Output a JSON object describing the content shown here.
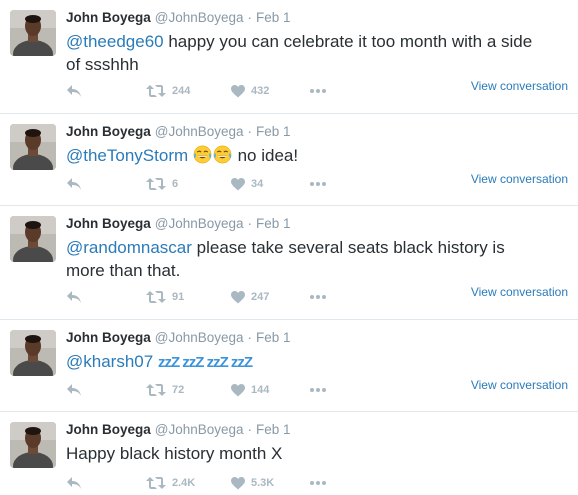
{
  "tweets": [
    {
      "name": "John Boyega",
      "handle": "@JohnBoyega",
      "separator": "·",
      "date": "Feb 1",
      "mention": "@theedge60",
      "text": " happy you can celebrate it too month with a side of ssshhh",
      "retweets": "244",
      "likes": "432",
      "view_conversation": "View conversation"
    },
    {
      "name": "John Boyega",
      "handle": "@JohnBoyega",
      "separator": "·",
      "date": "Feb 1",
      "mention": "@theTonyStorm",
      "text": " no idea!",
      "emoji": [
        "face-with-tears-of-joy",
        "face-with-tears-of-joy"
      ],
      "retweets": "6",
      "likes": "34",
      "view_conversation": "View conversation"
    },
    {
      "name": "John Boyega",
      "handle": "@JohnBoyega",
      "separator": "·",
      "date": "Feb 1",
      "mention": "@randomnascar",
      "text": " please take several seats black history is more than that.",
      "retweets": "91",
      "likes": "247",
      "view_conversation": "View conversation"
    },
    {
      "name": "John Boyega",
      "handle": "@JohnBoyega",
      "separator": "·",
      "date": "Feb 1",
      "mention": "@kharsh07",
      "zzz": "zzZ zzZ zzZ zzZ",
      "retweets": "72",
      "likes": "144",
      "view_conversation": "View conversation"
    },
    {
      "name": "John Boyega",
      "handle": "@JohnBoyega",
      "separator": "·",
      "date": "Feb 1",
      "text": "Happy black history month X",
      "retweets": "2.4K",
      "likes": "5.3K"
    }
  ],
  "colors": {
    "link": "#2b7bb9",
    "muted": "#8899a6",
    "icon": "#aab8c2",
    "divider": "#e1e8ed"
  },
  "icons": [
    "reply-icon",
    "retweet-icon",
    "heart-icon",
    "more-icon"
  ]
}
